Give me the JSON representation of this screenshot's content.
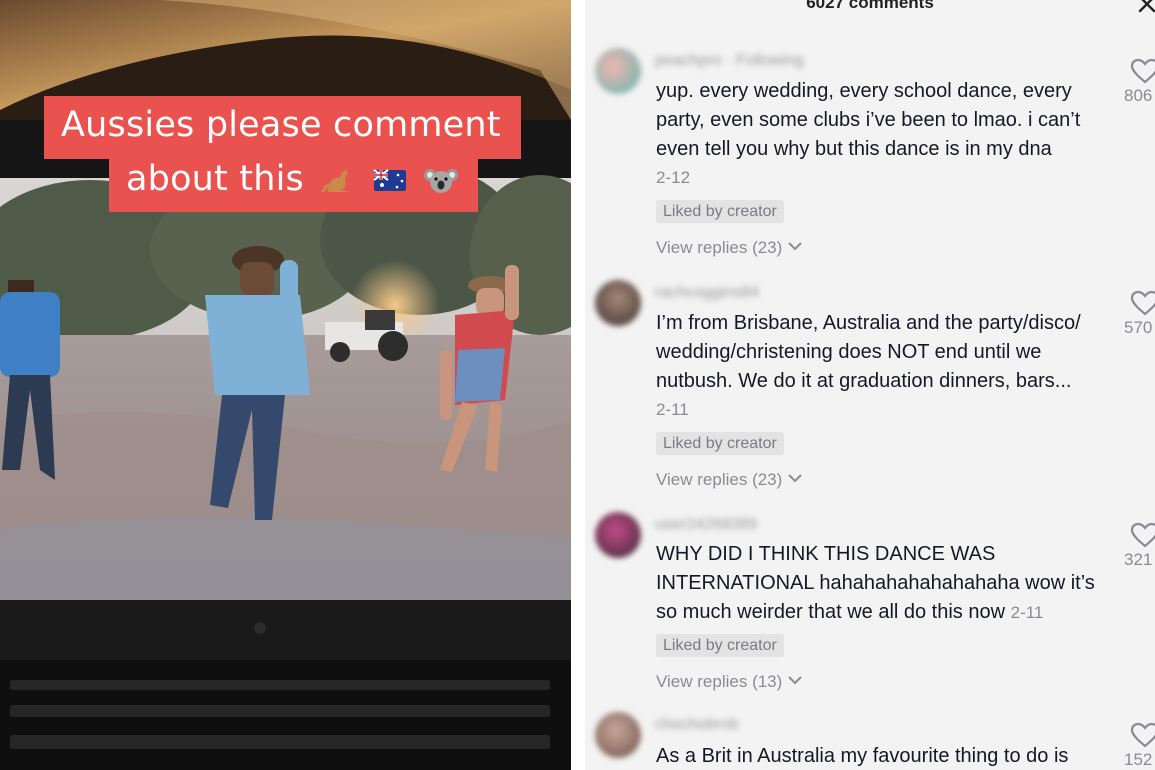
{
  "video": {
    "caption_line_1": "Aussies please comment",
    "caption_line_2": "about this",
    "caption_emojis": [
      "kangaroo-emoji",
      "australia-flag-emoji",
      "koala-emoji"
    ]
  },
  "comments_panel": {
    "header": "6027 comments",
    "close_icon": "close-icon",
    "comments": [
      {
        "username": "peachpro · Following",
        "text": "yup. every wedding, every school dance, every party, even some clubs i’ve been to lmao. i can’t even tell you why but this dance is in my dna",
        "date": "2-12",
        "liked_badge": "Liked by creator",
        "replies": "View replies (23)",
        "likes": "806"
      },
      {
        "username": "rachcoggins84",
        "text": "I’m from Brisbane, Australia and the party/disco/ wedding/christening does NOT end until we nutbush. We do it at graduation dinners, bars...",
        "date": "2-11",
        "liked_badge": "Liked by creator",
        "replies": "View replies (23)",
        "likes": "570"
      },
      {
        "username": "user24268389",
        "text": "WHY DID I THINK THIS DANCE WAS INTERNATIONAL hahahahahahahahaha wow it’s so much weirder that we all do this now",
        "date": "2-11",
        "liked_badge": "Liked by creator",
        "replies": "View replies (13)",
        "likes": "321"
      },
      {
        "username": "chochobrob",
        "text": "As a Brit in Australia my favourite thing to do is",
        "likes": "152"
      }
    ]
  },
  "colors": {
    "caption_background": "#e9524f",
    "panel_background": "#f3f3f3",
    "muted_text": "#8a8b91"
  }
}
